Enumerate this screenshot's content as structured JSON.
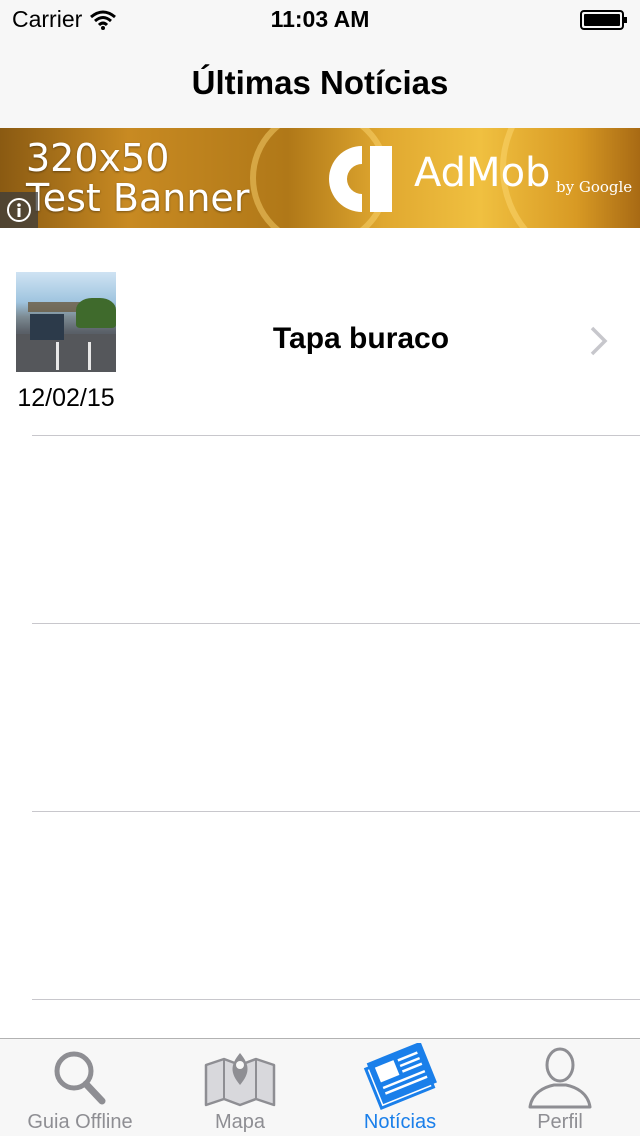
{
  "status_bar": {
    "carrier": "Carrier",
    "time": "11:03 AM"
  },
  "nav": {
    "title": "Últimas Notícias"
  },
  "ad": {
    "line1": "320x50",
    "line2": "Test Banner",
    "brand": "AdMob",
    "by": "by Google",
    "info_icon": "info-icon"
  },
  "news": [
    {
      "title": "Tapa buraco",
      "date": "12/02/15",
      "thumbnail": "road-repair-photo"
    }
  ],
  "tabs": [
    {
      "label": "Guia Offline",
      "icon": "search-icon",
      "active": false
    },
    {
      "label": "Mapa",
      "icon": "map-icon",
      "active": false
    },
    {
      "label": "Notícias",
      "icon": "newspaper-icon",
      "active": true
    },
    {
      "label": "Perfil",
      "icon": "person-icon",
      "active": false
    }
  ],
  "colors": {
    "accent": "#1a7fea",
    "inactive": "#8e8e93",
    "separator": "#c8c7cc",
    "bar": "#f7f7f7"
  }
}
